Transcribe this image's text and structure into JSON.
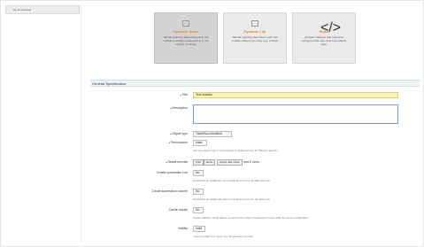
{
  "sidebar": {
    "back_label": "Go to overview"
  },
  "cards": [
    {
      "title": "Dynamic Static",
      "desc": "Tabular reporting data where each row contains a snapper data point (e.g. the number of tickets)"
    },
    {
      "title": "Dynamic List",
      "desc": "Tabular reporting data where each row contains data of one entry (e.g. a ticket)"
    },
    {
      "title": "Static",
      "desc": "Complex statistics that cannot be configured and may return non-tabular data."
    }
  ],
  "section": {
    "title": "General Specification"
  },
  "form": {
    "title_label": "Title",
    "title_value": "Test statistic",
    "description_label": "Description",
    "object_type_label": "Object type",
    "object_type_value": "TicketAccumulation",
    "permissions_label": "Permissions",
    "permissions_value": "stats",
    "permissions_hint": "You can select one or more groups to define access for different agents.",
    "result_formats_label": "Result formats",
    "result_formats": [
      "CSV",
      "Excel",
      "Graph: Bar Chart"
    ],
    "result_formats_more": "and 5 more...",
    "create_sum_row_label": "Create summation row",
    "create_sum_row_value": "No",
    "create_sum_row_hint": "Generates an additional row containing sums for all data columns.",
    "create_sum_col_label": "Create summation column",
    "create_sum_col_value": "No",
    "create_sum_col_hint": "Generates an additional column containing sums for all data rows.",
    "cache_label": "Cache results",
    "cache_value": "No",
    "cache_hint": "Stores statistics result data in a cache to be used in subsequent views with the same configuration.",
    "validity_label": "Validity",
    "validity_value": "valid",
    "validity_hint": "If set to invalid end users can not generate the stat."
  }
}
